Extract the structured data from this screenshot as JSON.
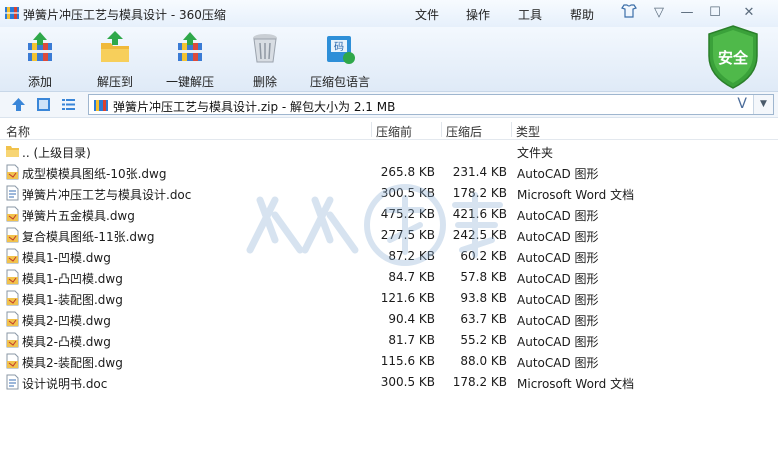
{
  "window": {
    "title": "弹簧片冲压工艺与模具设计 - 360压缩",
    "menus": [
      "文件",
      "操作",
      "工具",
      "帮助"
    ]
  },
  "toolbar": {
    "buttons": [
      {
        "label": "添加",
        "icon": "add-books-icon"
      },
      {
        "label": "解压到",
        "icon": "extract-folder-icon"
      },
      {
        "label": "一键解压",
        "icon": "one-click-extract-icon"
      },
      {
        "label": "删除",
        "icon": "trash-bin-icon"
      },
      {
        "label": "压缩包语言",
        "icon": "archive-language-icon"
      }
    ],
    "security_badge": "安全"
  },
  "address": {
    "path": "弹簧片冲压工艺与模具设计.zip - 解包大小为 2.1 MB",
    "search_glyph": "V"
  },
  "columns": {
    "name": "名称",
    "packed": "压缩前",
    "unpacked": "压缩后",
    "type": "类型"
  },
  "files": [
    {
      "name": ".. (上级目录)",
      "packed": "",
      "unpacked": "",
      "type": "文件夹",
      "icon": "folder-icon"
    },
    {
      "name": "成型模模具图纸-10张.dwg",
      "packed": "265.8 KB",
      "unpacked": "231.4 KB",
      "type": "AutoCAD 图形",
      "icon": "dwg-file-icon"
    },
    {
      "name": "弹簧片冲压工艺与模具设计.doc",
      "packed": "300.5 KB",
      "unpacked": "178.2 KB",
      "type": "Microsoft Word 文档",
      "icon": "doc-file-icon"
    },
    {
      "name": "弹簧片五金模具.dwg",
      "packed": "475.2 KB",
      "unpacked": "421.6 KB",
      "type": "AutoCAD 图形",
      "icon": "dwg-file-icon"
    },
    {
      "name": "复合模具图纸-11张.dwg",
      "packed": "277.5 KB",
      "unpacked": "242.5 KB",
      "type": "AutoCAD 图形",
      "icon": "dwg-file-icon"
    },
    {
      "name": "模具1-凹模.dwg",
      "packed": "87.2 KB",
      "unpacked": "60.2 KB",
      "type": "AutoCAD 图形",
      "icon": "dwg-file-icon"
    },
    {
      "name": "模具1-凸凹模.dwg",
      "packed": "84.7 KB",
      "unpacked": "57.8 KB",
      "type": "AutoCAD 图形",
      "icon": "dwg-file-icon"
    },
    {
      "name": "模具1-装配图.dwg",
      "packed": "121.6 KB",
      "unpacked": "93.8 KB",
      "type": "AutoCAD 图形",
      "icon": "dwg-file-icon"
    },
    {
      "name": "模具2-凹模.dwg",
      "packed": "90.4 KB",
      "unpacked": "63.7 KB",
      "type": "AutoCAD 图形",
      "icon": "dwg-file-icon"
    },
    {
      "name": "模具2-凸模.dwg",
      "packed": "81.7 KB",
      "unpacked": "55.2 KB",
      "type": "AutoCAD 图形",
      "icon": "dwg-file-icon"
    },
    {
      "name": "模具2-装配图.dwg",
      "packed": "115.6 KB",
      "unpacked": "88.0 KB",
      "type": "AutoCAD 图形",
      "icon": "dwg-file-icon"
    },
    {
      "name": "设计说明书.doc",
      "packed": "300.5 KB",
      "unpacked": "178.2 KB",
      "type": "Microsoft Word 文档",
      "icon": "doc-file-icon"
    }
  ],
  "colors": {
    "accent": "#2a6fc0",
    "shield_green": "#3aa13a",
    "folder_yellow": "#f1c24c"
  }
}
